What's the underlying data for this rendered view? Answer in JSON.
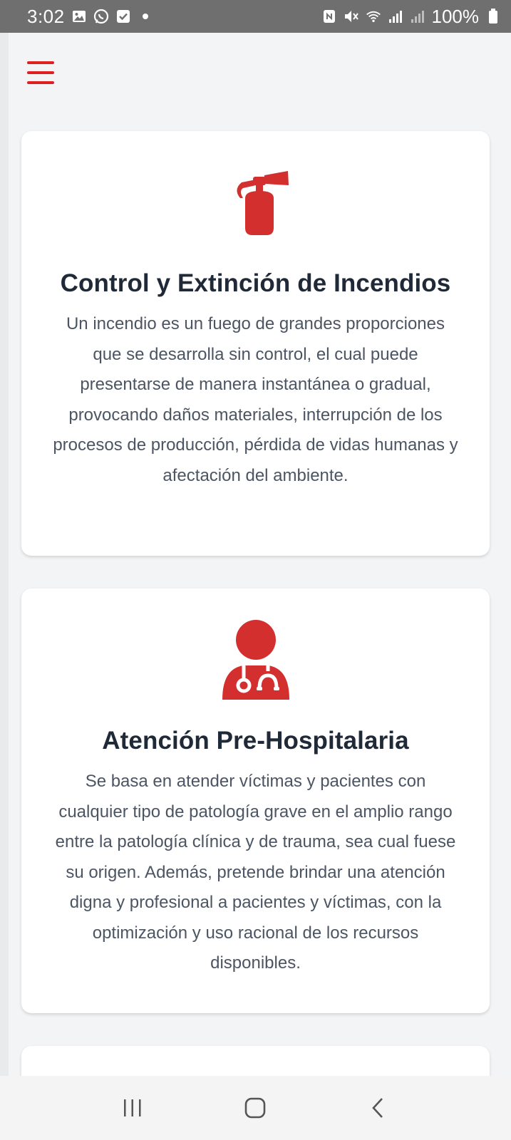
{
  "status_bar": {
    "time": "3:02",
    "battery": "100%",
    "icons_left": [
      "gallery-icon",
      "whatsapp-icon",
      "check-icon",
      "dot-icon"
    ],
    "icons_right": [
      "nfc-icon",
      "mute-icon",
      "wifi-icon",
      "signal-icon",
      "signal-icon",
      "battery-icon"
    ]
  },
  "menu": {
    "icon": "hamburger-menu-icon",
    "color": "#e02020"
  },
  "cards": [
    {
      "icon": "fire-extinguisher-icon",
      "title": "Control y Extinción de Incendios",
      "text": "Un incendio es un fuego de grandes proporciones que se desarrolla sin control, el cual puede presentarse de manera instantánea o gradual, provocando daños materiales, interrupción de los procesos de producción, pérdida de vidas humanas y afectación del ambiente."
    },
    {
      "icon": "doctor-stethoscope-icon",
      "title": "Atención Pre-Hospitalaria",
      "text": "Se basa en atender víctimas y pacientes con cualquier tipo de patología grave en el amplio rango entre la patología clínica y de trauma, sea cual fuese su origen. Además, pretende brindar una atención digna y profesional a pacientes y víctimas, con la optimización y uso racional de los recursos disponibles."
    }
  ],
  "colors": {
    "accent": "#d32f2f",
    "title": "#1f2937",
    "body_text": "#4b5563",
    "background": "#f3f4f6",
    "card": "#ffffff"
  },
  "nav_bar": {
    "buttons": [
      "recent-apps-icon",
      "home-icon",
      "back-icon"
    ]
  }
}
